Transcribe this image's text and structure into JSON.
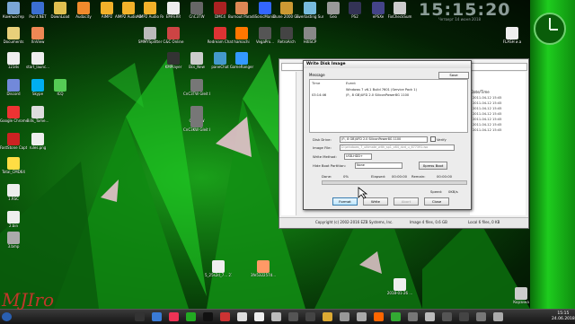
{
  "clock": {
    "time": "15:15:20",
    "sub": "Четверг 14 июня 2018"
  },
  "desktop_icons": [
    {
      "label": "Компьютер",
      "color": "#7aa6d6"
    },
    {
      "label": "Paint.NET",
      "color": "#3b6fd1"
    },
    {
      "label": "DownLoad",
      "color": "#e0c050"
    },
    {
      "label": "Audacity",
      "color": "#f08a2c"
    },
    {
      "label": "AIMP2",
      "color": "#f2b12a"
    },
    {
      "label": "AIMP2 Audio Grabber",
      "color": "#f2b12a"
    },
    {
      "label": "AIMP2 Audio Recorder",
      "color": "#f2b12a"
    },
    {
      "label": "EMFERR",
      "color": "#eee"
    },
    {
      "label": "CnC3TW",
      "color": "#666"
    },
    {
      "label": "DMC4",
      "color": "#a22"
    },
    {
      "label": "Burnout Paradise",
      "color": "#d85"
    },
    {
      "label": "SonicMania",
      "color": "#36f"
    },
    {
      "label": "Dune 2000 Gruntmo...",
      "color": "#c93"
    },
    {
      "label": "Everlasting Summer",
      "color": "#7bd"
    },
    {
      "label": "Geo",
      "color": "#999"
    },
    {
      "label": "PS2",
      "color": "#335"
    },
    {
      "label": "ePSXe",
      "color": "#448"
    },
    {
      "label": "FixCheckSum",
      "color": "#ccc"
    },
    {
      "label": "Documents",
      "color": "#e8d07a"
    },
    {
      "label": "XnView",
      "color": "#e85"
    },
    {
      "label": "SMMYSplitter",
      "color": "#bbb"
    },
    {
      "label": "C&C Online",
      "color": "#c44"
    },
    {
      "label": "Redream Chat",
      "color": "#d33"
    },
    {
      "label": "hamachi",
      "color": "#f70"
    },
    {
      "label": "VegaPro...",
      "color": "#555"
    },
    {
      "label": "RetroArch",
      "color": "#444"
    },
    {
      "label": "HitiSCP",
      "color": "#888"
    },
    {
      "label": "FLASH и.а",
      "color": "#eee"
    },
    {
      "label": "1234s",
      "color": "#eee"
    },
    {
      "label": "start_launc...",
      "color": "#eee"
    },
    {
      "label": "KMPlayer",
      "color": "#333"
    },
    {
      "label": "Bcs_New",
      "color": "#ccc"
    },
    {
      "label": "paneChat",
      "color": "#49c"
    },
    {
      "label": "GameRanger",
      "color": "#39f"
    },
    {
      "label": "Discord",
      "color": "#7289da"
    },
    {
      "label": "Skype",
      "color": "#00aff0"
    },
    {
      "label": "ICQ",
      "color": "#5c5"
    },
    {
      "label": "CnC3TW Gleit Logon",
      "color": "#777"
    },
    {
      "label": "Google Chrome",
      "color": "#e33"
    },
    {
      "label": "Bills_Tome...",
      "color": "#ddd"
    },
    {
      "label": "CnC3KW",
      "color": "#777"
    },
    {
      "label": "CnC3KW Gleit Logon",
      "color": "#777"
    },
    {
      "label": "FastStone Capture",
      "color": "#c22"
    },
    {
      "label": "rules.png",
      "color": "#eee"
    },
    {
      "label": "Total_CMD64",
      "color": "#fd4"
    },
    {
      "label": "1.RSC",
      "color": "#eee"
    },
    {
      "label": "2.bin",
      "color": "#eee"
    },
    {
      "label": "3.bmp",
      "color": "#aaa"
    },
    {
      "label": "5_25s2d_7... 21367637...",
      "color": "#eee"
    },
    {
      "label": "3fe532257d...",
      "color": "#f96"
    },
    {
      "label": "2018-01-26 ...",
      "color": "#eee"
    },
    {
      "label": "Корзина",
      "color": "#ccc"
    }
  ],
  "explorer": {
    "date_header": "Date/Time",
    "dates": [
      "2011-04-12 15:45",
      "2011-04-12 15:45",
      "2011-04-12 15:45",
      "2011-04-12 15:45",
      "2011-04-12 15:45",
      "2011-04-12 15:45",
      "2011-04-12 15:45"
    ],
    "status_left": "Copyright (c) 2002-2016 EZB Systems, Inc.",
    "status_mid": "Image 4 files, 0.6 GB",
    "status_right": "Local 6 files, 0 KB"
  },
  "dialog": {
    "title": "Write Disk Image",
    "save_label": "Save",
    "message_header": "Message",
    "col_time": "Time",
    "col_event": "Event",
    "rows": [
      {
        "time": "",
        "event": "Windows 7 v6.1 Build 7601 (Service Pack 1)"
      },
      {
        "time": "03:14:46",
        "event": "(F:, 8 GB)UFD 2.0 SiliconPower8G 1100"
      }
    ],
    "disk_drive_label": "Disk Drive:",
    "disk_drive_value": "(F:, 8 GB)UFD 2.0 SiliconPower8G 1100",
    "verify_label": "Verify",
    "image_file_label": "Image File:",
    "image_file_value": "D:\\windows_7_ultimate_with_sp1_x64_dvd_u_677391.iso",
    "write_method_label": "Write Method:",
    "write_method_value": "USB-HDD+",
    "hide_boot_label": "Hide Boot Partition:",
    "hide_boot_value": "None",
    "xpress_label": "Xpress Boot",
    "done_label": "Done:",
    "done_value": "0%",
    "elapsed_label": "Elapsed:",
    "elapsed_value": "00:00:00",
    "remain_label": "Remain:",
    "remain_value": "00:00:00",
    "speed_label": "Speed:",
    "speed_value": "0KB/s",
    "format_label": "Format",
    "write_label": "Write",
    "abort_label": "Abort",
    "close_label": "Close"
  },
  "taskbar": {
    "items": [
      "#333",
      "#3a7bd5",
      "#e35",
      "#2a2",
      "#111",
      "#c33",
      "#ddd",
      "#eee",
      "#bbb",
      "#555",
      "#444",
      "#da3",
      "#999",
      "#aaa",
      "#f60",
      "#3a3",
      "#777",
      "#bbb",
      "#555",
      "#444",
      "#777",
      "#aaa"
    ],
    "time": "15:15",
    "date": "24.06.2018"
  },
  "watermark": "MJIro"
}
